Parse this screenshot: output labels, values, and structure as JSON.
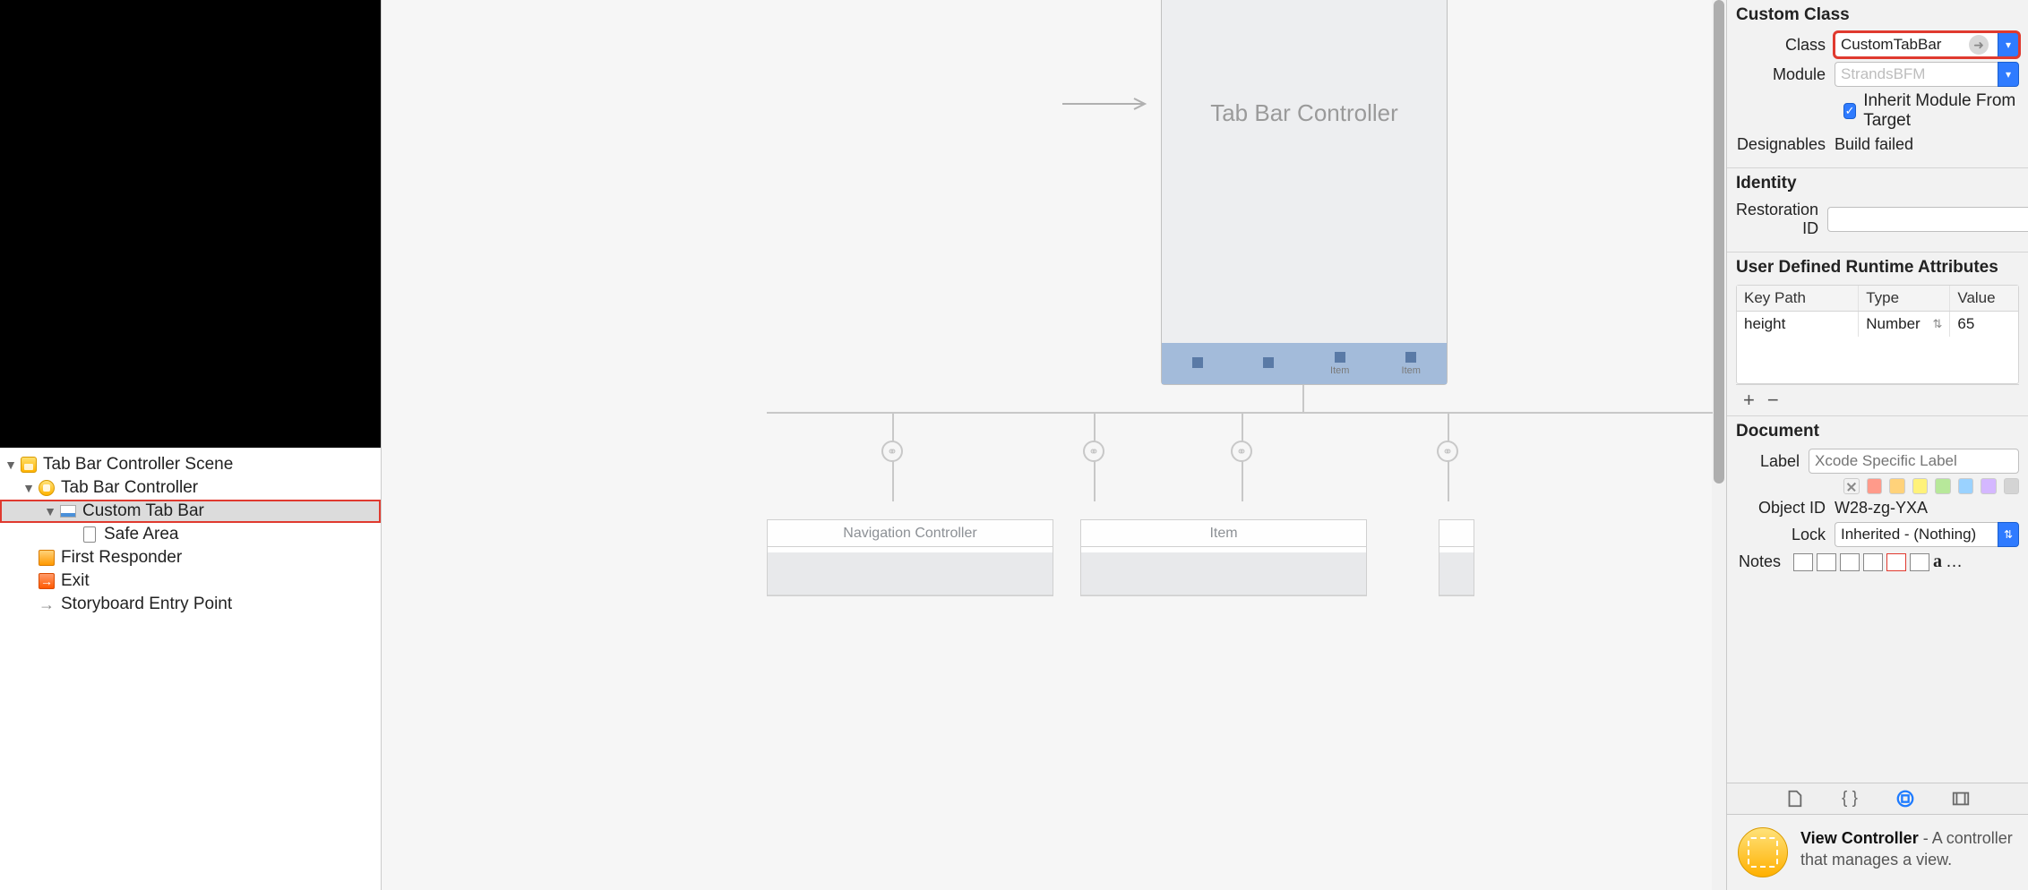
{
  "outline": {
    "scene": "Tab Bar Controller Scene",
    "items": [
      {
        "label": "Tab Bar Controller"
      },
      {
        "label": "Custom Tab Bar"
      },
      {
        "label": "Safe Area"
      },
      {
        "label": "First Responder"
      },
      {
        "label": "Exit"
      },
      {
        "label": "Storyboard Entry Point"
      }
    ]
  },
  "canvas": {
    "device_title": "Tab Bar Controller",
    "tab_items": [
      "",
      "",
      "Item",
      "Item"
    ],
    "children": [
      "Navigation Controller",
      "Item",
      ""
    ]
  },
  "inspector": {
    "custom_class": {
      "title": "Custom Class",
      "class_label": "Class",
      "class_value": "CustomTabBar",
      "module_label": "Module",
      "module_placeholder": "StrandsBFM",
      "inherit_label": "Inherit Module From Target",
      "designables_label": "Designables",
      "designables_value": "Build failed"
    },
    "identity": {
      "title": "Identity",
      "restoration_label": "Restoration ID"
    },
    "runtime": {
      "title": "User Defined Runtime Attributes",
      "headers": {
        "key": "Key Path",
        "type": "Type",
        "value": "Value"
      },
      "row": {
        "key": "height",
        "type": "Number",
        "value": "65"
      }
    },
    "document": {
      "title": "Document",
      "label_label": "Label",
      "label_placeholder": "Xcode Specific Label",
      "object_id_label": "Object ID",
      "object_id_value": "W28-zg-YXA",
      "lock_label": "Lock",
      "lock_value": "Inherited - (Nothing)",
      "notes_label": "Notes"
    },
    "library": {
      "name": "View Controller",
      "desc": " - A controller that manages a view."
    }
  }
}
